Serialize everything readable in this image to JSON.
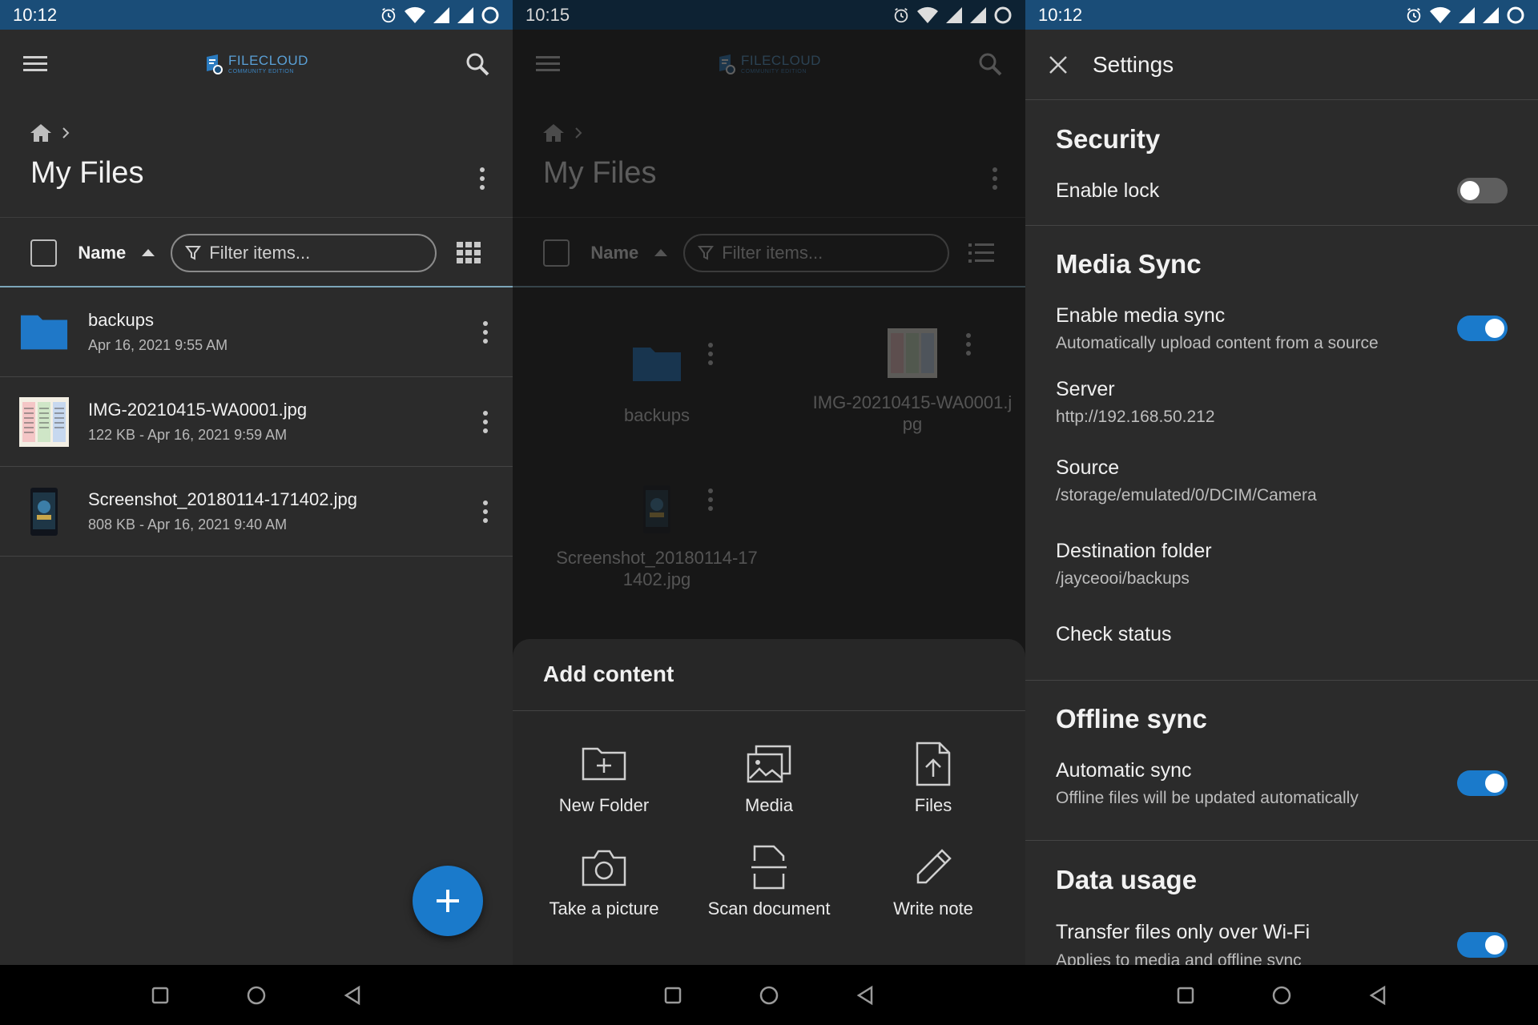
{
  "colors": {
    "status_bar": "#1a4d78",
    "background": "#2b2b2b",
    "accent": "#1a7acb",
    "folder": "#1f78c8"
  },
  "panel1": {
    "status": {
      "time": "10:12"
    },
    "logo": {
      "name": "FILECLOUD",
      "sub": "COMMUNITY EDITION"
    },
    "title": "My Files",
    "sort_label": "Name",
    "filter_placeholder": "Filter items...",
    "files": [
      {
        "name": "backups",
        "meta": "Apr 16, 2021 9:55 AM",
        "icon": "folder-icon"
      },
      {
        "name": "IMG-20210415-WA0001.jpg",
        "meta": "122 KB - Apr 16, 2021 9:59 AM",
        "icon": "image-thumbnail"
      },
      {
        "name": "Screenshot_20180114-171402.jpg",
        "meta": "808 KB - Apr 16, 2021 9:40 AM",
        "icon": "screenshot-thumbnail"
      }
    ]
  },
  "panel2": {
    "status": {
      "time": "10:15"
    },
    "logo": {
      "name": "FILECLOUD",
      "sub": "COMMUNITY EDITION"
    },
    "title": "My Files",
    "sort_label": "Name",
    "filter_placeholder": "Filter items...",
    "grid": [
      {
        "name": "backups"
      },
      {
        "name": "IMG-20210415-WA0001.j\npg"
      },
      {
        "name": "Screenshot_20180114-17\n1402.jpg"
      }
    ],
    "sheet": {
      "title": "Add content",
      "actions": [
        {
          "label": "New Folder",
          "icon": "new-folder-icon"
        },
        {
          "label": "Media",
          "icon": "media-icon"
        },
        {
          "label": "Files",
          "icon": "file-upload-icon"
        },
        {
          "label": "Take a picture",
          "icon": "camera-icon"
        },
        {
          "label": "Scan document",
          "icon": "scan-icon"
        },
        {
          "label": "Write note",
          "icon": "pencil-icon"
        }
      ]
    }
  },
  "panel3": {
    "status": {
      "time": "10:12"
    },
    "title": "Settings",
    "security": {
      "title": "Security",
      "enable_lock": "Enable lock",
      "enable_lock_on": false
    },
    "media_sync": {
      "title": "Media Sync",
      "enable": "Enable media sync",
      "enable_sub": "Automatically upload content from a source",
      "enable_on": true,
      "server_label": "Server",
      "server_value": "http://192.168.50.212",
      "source_label": "Source",
      "source_value": "/storage/emulated/0/DCIM/Camera",
      "dest_label": "Destination folder",
      "dest_value": "/jayceooi/backups",
      "check_status": "Check status"
    },
    "offline_sync": {
      "title": "Offline sync",
      "auto": "Automatic sync",
      "auto_sub": "Offline files will be updated automatically",
      "auto_on": true
    },
    "data_usage": {
      "title": "Data usage",
      "wifi": "Transfer files only over Wi-Fi",
      "wifi_sub": "Applies to media and offline sync",
      "wifi_on": true
    }
  }
}
